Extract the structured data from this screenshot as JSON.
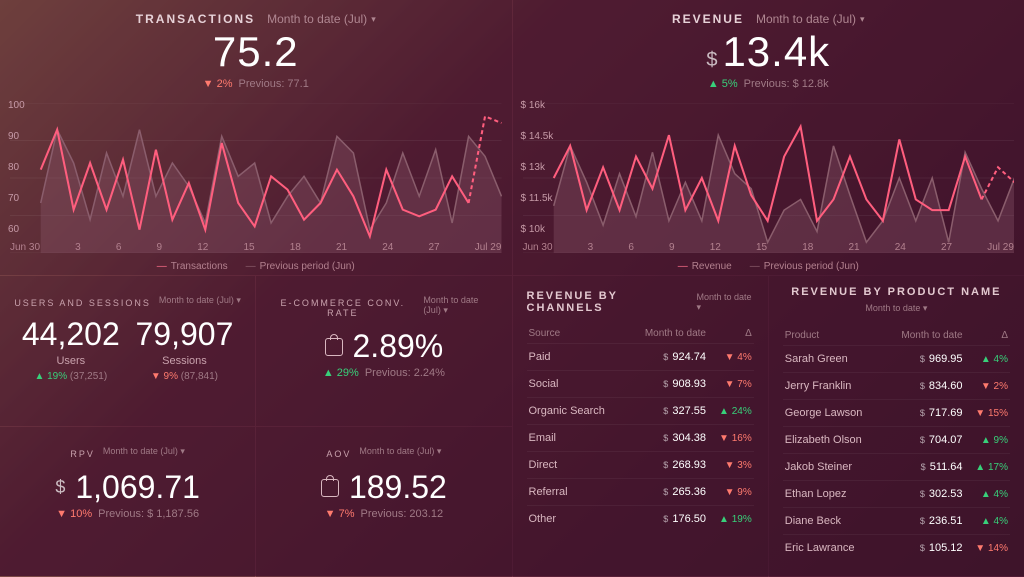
{
  "chart_data": [
    {
      "id": "transactions",
      "type": "line",
      "title": "TRANSACTIONS",
      "period": "Month to date (Jul)",
      "value": "75.2",
      "delta_pct": "2%",
      "delta_dir": "down",
      "previous_label": "Previous: 77.1",
      "xlabel": "",
      "ylabel": "",
      "ylim": [
        55,
        100
      ],
      "y_ticks": [
        "100",
        "90",
        "80",
        "70",
        "60"
      ],
      "x_ticks": [
        "Jun 30",
        "3",
        "6",
        "9",
        "12",
        "15",
        "18",
        "21",
        "24",
        "27",
        "Jul 29"
      ],
      "series": [
        {
          "name": "Transactions",
          "values": [
            80,
            92,
            68,
            82,
            68,
            83,
            62,
            86,
            65,
            76,
            62,
            88,
            70,
            63,
            78,
            74,
            65,
            70,
            80,
            72,
            60,
            80,
            68,
            66,
            68,
            78,
            70,
            96,
            94
          ]
        },
        {
          "name": "Previous period (Jun)",
          "values": [
            70,
            92,
            82,
            65,
            85,
            72,
            92,
            72,
            82,
            75,
            64,
            90,
            78,
            82,
            64,
            72,
            78,
            70,
            90,
            85,
            62,
            70,
            85,
            72,
            86,
            64,
            90,
            84,
            72
          ]
        }
      ],
      "legend": [
        "Transactions",
        "Previous period (Jun)"
      ]
    },
    {
      "id": "revenue",
      "type": "line",
      "title": "REVENUE",
      "period": "Month to date (Jul)",
      "value_prefix": "$",
      "value": "13.4k",
      "delta_pct": "5%",
      "delta_dir": "up",
      "previous_label": "Previous: $ 12.8k",
      "xlabel": "",
      "ylabel": "",
      "ylim": [
        9500,
        16500
      ],
      "y_ticks": [
        "$ 16k",
        "$ 14.5k",
        "$ 13k",
        "$ 11.5k",
        "$ 10k"
      ],
      "x_ticks": [
        "Jun 30",
        "3",
        "6",
        "9",
        "12",
        "15",
        "18",
        "21",
        "24",
        "27",
        "Jul 29"
      ],
      "series": [
        {
          "name": "Revenue",
          "values": [
            13.0,
            14.5,
            11.5,
            13.5,
            11.5,
            14.0,
            12.5,
            15.0,
            11.5,
            13.0,
            11.0,
            14.5,
            12.2,
            11.0,
            14.0,
            15.4,
            11.0,
            12.0,
            14.0,
            12.0,
            11.0,
            14.8,
            12.0,
            11.5,
            11.5,
            14.0,
            12.0,
            13.5,
            12.8
          ]
        },
        {
          "name": "Previous period (Jun)",
          "values": [
            11.7,
            14.5,
            12.8,
            10.8,
            13.2,
            11.2,
            14.2,
            11.0,
            12.8,
            11.0,
            15.0,
            13.2,
            12.5,
            10.0,
            11.5,
            12.0,
            10.5,
            14.5,
            12.2,
            10.0,
            11.0,
            13.0,
            11.0,
            13.0,
            10.0,
            14.2,
            12.5,
            11.0,
            13.0
          ]
        }
      ],
      "legend": [
        "Revenue",
        "Previous period (Jun)"
      ]
    }
  ],
  "cards": {
    "users_sessions": {
      "title": "USERS AND SESSIONS",
      "period": "Month to date (Jul)",
      "users_value": "44,202",
      "users_label": "Users",
      "users_delta": "19%",
      "users_delta_dir": "up",
      "users_prev": "(37,251)",
      "sessions_value": "79,907",
      "sessions_label": "Sessions",
      "sessions_delta": "9%",
      "sessions_delta_dir": "down",
      "sessions_prev": "(87,841)"
    },
    "conv_rate": {
      "title": "E-COMMERCE CONV. RATE",
      "period": "Month to date (Jul)",
      "value": "2.89%",
      "delta": "29%",
      "delta_dir": "up",
      "previous": "Previous: 2.24%"
    },
    "rpv": {
      "title": "RPV",
      "period": "Month to date (Jul)",
      "value": "1,069.71",
      "prefix": "$",
      "delta": "10%",
      "delta_dir": "down",
      "previous": "Previous: $ 1,187.56"
    },
    "aov": {
      "title": "AOV",
      "period": "Month to date (Jul)",
      "value": "189.52",
      "delta": "7%",
      "delta_dir": "down",
      "previous": "Previous: 203.12"
    }
  },
  "channels": {
    "title": "REVENUE BY CHANNELS",
    "period": "Month to date",
    "col_source": "Source",
    "col_mtd": "Month to date",
    "col_delta": "Δ",
    "rows": [
      {
        "source": "Paid",
        "value": "924.74",
        "delta": "4%",
        "dir": "down"
      },
      {
        "source": "Social",
        "value": "908.93",
        "delta": "7%",
        "dir": "down"
      },
      {
        "source": "Organic Search",
        "value": "327.55",
        "delta": "24%",
        "dir": "up"
      },
      {
        "source": "Email",
        "value": "304.38",
        "delta": "16%",
        "dir": "down"
      },
      {
        "source": "Direct",
        "value": "268.93",
        "delta": "3%",
        "dir": "down"
      },
      {
        "source": "Referral",
        "value": "265.36",
        "delta": "9%",
        "dir": "down"
      },
      {
        "source": "Other",
        "value": "176.50",
        "delta": "19%",
        "dir": "up"
      }
    ]
  },
  "products": {
    "title": "REVENUE BY PRODUCT NAME",
    "period": "Month to date",
    "col_product": "Product",
    "col_mtd": "Month to date",
    "col_delta": "Δ",
    "rows": [
      {
        "product": "Sarah Green",
        "value": "969.95",
        "delta": "4%",
        "dir": "up"
      },
      {
        "product": "Jerry Franklin",
        "value": "834.60",
        "delta": "2%",
        "dir": "down"
      },
      {
        "product": "George Lawson",
        "value": "717.69",
        "delta": "15%",
        "dir": "down"
      },
      {
        "product": "Elizabeth Olson",
        "value": "704.07",
        "delta": "9%",
        "dir": "up"
      },
      {
        "product": "Jakob Steiner",
        "value": "511.64",
        "delta": "17%",
        "dir": "up"
      },
      {
        "product": "Ethan Lopez",
        "value": "302.53",
        "delta": "4%",
        "dir": "up"
      },
      {
        "product": "Diane Beck",
        "value": "236.51",
        "delta": "4%",
        "dir": "up"
      },
      {
        "product": "Eric Lawrance",
        "value": "105.12",
        "delta": "14%",
        "dir": "down"
      }
    ]
  }
}
